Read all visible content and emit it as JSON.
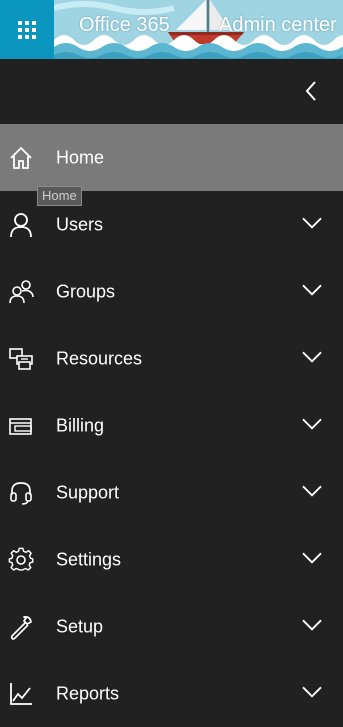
{
  "header": {
    "product": "Office 365",
    "section": "Admin center",
    "waffle_icon": "app-launcher-icon"
  },
  "collapse": {
    "icon": "chevron-left-icon"
  },
  "nav": {
    "items": [
      {
        "label": "Home",
        "icon": "home-icon",
        "active": true,
        "expandable": false
      },
      {
        "label": "Users",
        "icon": "user-icon",
        "expandable": true
      },
      {
        "label": "Groups",
        "icon": "groups-icon",
        "expandable": true
      },
      {
        "label": "Resources",
        "icon": "resources-icon",
        "expandable": true
      },
      {
        "label": "Billing",
        "icon": "billing-icon",
        "expandable": true
      },
      {
        "label": "Support",
        "icon": "headset-icon",
        "expandable": true
      },
      {
        "label": "Settings",
        "icon": "gear-icon",
        "expandable": true
      },
      {
        "label": "Setup",
        "icon": "wrench-icon",
        "expandable": true
      },
      {
        "label": "Reports",
        "icon": "chart-icon",
        "expandable": true
      }
    ]
  },
  "tooltip": {
    "text": "Home"
  },
  "colors": {
    "sidebar_bg": "#212121",
    "active_bg": "#7a7a7a",
    "waffle_bg": "#0a96bf",
    "banner_sky": "#9fd4e3"
  }
}
